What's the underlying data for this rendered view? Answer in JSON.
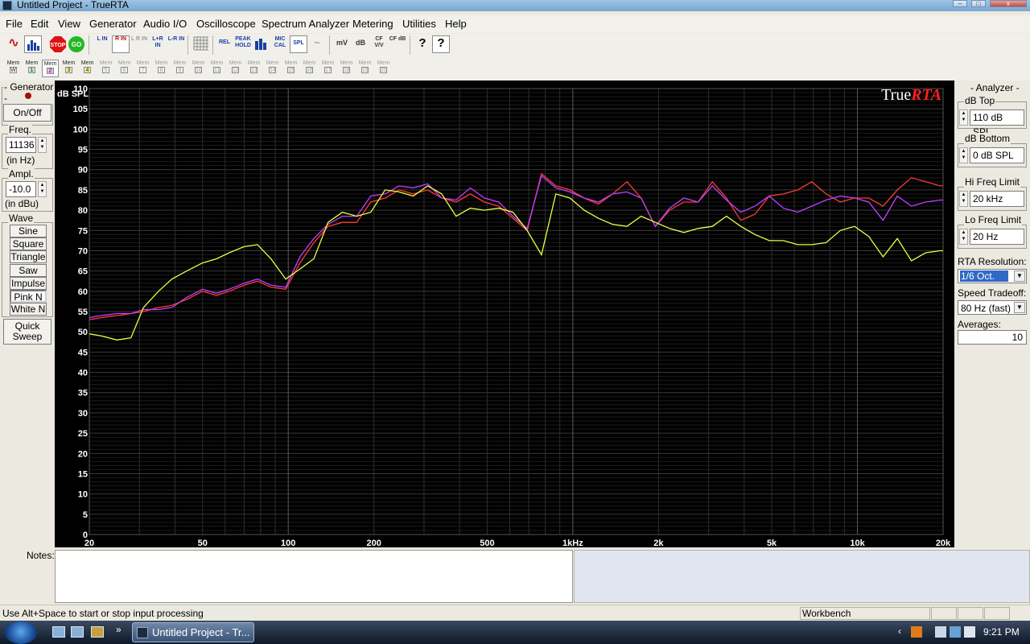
{
  "window": {
    "title": "Untitled Project - TrueRTA",
    "min": "–",
    "max": "□",
    "close": "x"
  },
  "menu": [
    "File",
    "Edit",
    "View",
    "Generator",
    "Audio I/O",
    "Oscilloscope",
    "Spectrum Analyzer",
    "Metering",
    "Utilities",
    "Help"
  ],
  "toolbar": {
    "buttons": [
      {
        "name": "sine-wave",
        "label": "∿"
      },
      {
        "name": "rta-bars",
        "label": ""
      },
      {
        "name": "stop",
        "label": "STOP"
      },
      {
        "name": "go",
        "label": "GO"
      },
      {
        "name": "l-in",
        "label": "L IN"
      },
      {
        "name": "r-in",
        "label": "R IN"
      },
      {
        "name": "l-r-in",
        "label": "L R IN"
      },
      {
        "name": "l-plus-r-in",
        "label": "L+R IN"
      },
      {
        "name": "l-minus-r-in",
        "label": "L-R IN"
      },
      {
        "name": "grid",
        "label": ""
      },
      {
        "name": "rel",
        "label": "REL"
      },
      {
        "name": "peak-hold",
        "label": "PEAK HOLD"
      },
      {
        "name": "bar-graph",
        "label": ""
      },
      {
        "name": "mic-cal",
        "label": "MIC CAL"
      },
      {
        "name": "spl",
        "label": "SPL"
      },
      {
        "name": "weighting",
        "label": "~"
      },
      {
        "name": "mv",
        "label": "mV"
      },
      {
        "name": "db",
        "label": "dB"
      },
      {
        "name": "cf-vv",
        "label": "CF V/V"
      },
      {
        "name": "cf-db",
        "label": "CF dB"
      },
      {
        "name": "help",
        "label": "?"
      },
      {
        "name": "context-help",
        "label": "?"
      }
    ],
    "mem_label": "Mem",
    "mem_buttons": [
      "W",
      "1",
      "2",
      "3",
      "4",
      "5",
      "6",
      "7",
      "8",
      "9",
      "10",
      "11",
      "12",
      "13",
      "14",
      "15",
      "16",
      "17",
      "18",
      "19",
      "20"
    ]
  },
  "generator": {
    "title": "- Generator -",
    "onoff": "On/Off",
    "freq_label": "Freq.",
    "freq_value": "11136",
    "freq_unit": "(in Hz)",
    "ampl_label": "Ampl.",
    "ampl_value": "-10.0",
    "ampl_unit": "(in dBu)",
    "wave_label": "Wave",
    "waves": [
      "Sine",
      "Square",
      "Triangle",
      "Saw",
      "Impulse",
      "Pink N",
      "White N"
    ],
    "selected_wave": "Pink N",
    "quick_sweep": "Quick\nSweep"
  },
  "analyzer": {
    "title": "- Analyzer -",
    "db_top_label": "dB Top",
    "db_top_value": "110 dB SPL",
    "db_bottom_label": "dB Bottom",
    "db_bottom_value": "0 dB SPL",
    "hi_freq_label": "Hi Freq Limit",
    "hi_freq_value": "20 kHz",
    "lo_freq_label": "Lo Freq Limit",
    "lo_freq_value": "20 Hz",
    "resolution_label": "RTA Resolution:",
    "resolution_value": "1/6 Oct.",
    "speed_label": "Speed Tradeoff:",
    "speed_value": "80 Hz (fast)",
    "averages_label": "Averages:",
    "averages_value": "10"
  },
  "notes_label": "Notes:",
  "status": {
    "message": "Use Alt+Space to start or stop input processing",
    "workbench": "Workbench"
  },
  "taskbar": {
    "task": "Untitled Project - Tr...",
    "time": "9:21 PM"
  },
  "chart_data": {
    "type": "line",
    "logo": "TrueRTA",
    "ylabel": "dB SPL",
    "ylim": [
      0,
      110
    ],
    "xlim": [
      20,
      20000
    ],
    "x_scale": "log",
    "grid": true,
    "yticks": [
      0,
      5,
      10,
      15,
      20,
      25,
      30,
      35,
      40,
      45,
      50,
      55,
      60,
      65,
      70,
      75,
      80,
      85,
      90,
      95,
      100,
      105,
      110
    ],
    "xticks": [
      {
        "v": 20,
        "label": "20"
      },
      {
        "v": 50,
        "label": "50"
      },
      {
        "v": 100,
        "label": "100"
      },
      {
        "v": 200,
        "label": "200"
      },
      {
        "v": 500,
        "label": "500"
      },
      {
        "v": 1000,
        "label": "1kHz"
      },
      {
        "v": 2000,
        "label": "2k"
      },
      {
        "v": 5000,
        "label": "5k"
      },
      {
        "v": 10000,
        "label": "10k"
      },
      {
        "v": 20000,
        "label": "20k"
      }
    ],
    "x": [
      20,
      22,
      25,
      28,
      31,
      35,
      39,
      44,
      50,
      56,
      62,
      70,
      78,
      87,
      98,
      110,
      123,
      138,
      155,
      174,
      195,
      219,
      245,
      275,
      309,
      346,
      389,
      436,
      489,
      549,
      616,
      691,
      776,
      871,
      977,
      1096,
      1230,
      1380,
      1549,
      1738,
      1950,
      2188,
      2455,
      2754,
      3090,
      3467,
      3890,
      4365,
      4898,
      5495,
      6166,
      6918,
      7762,
      8710,
      9772,
      10965,
      12303,
      13804,
      15488,
      17378,
      19498,
      20000
    ],
    "series": [
      {
        "color": "#ff3a3a",
        "values": [
          53,
          53.5,
          54,
          54.5,
          55,
          56,
          56.5,
          58,
          60,
          59,
          60,
          61.5,
          62.5,
          61,
          60.5,
          67,
          72,
          76,
          77,
          77,
          82,
          83,
          85,
          84,
          85,
          83,
          82,
          84,
          82,
          81,
          78,
          75,
          89,
          86,
          85,
          83,
          81.5,
          84,
          87,
          83,
          76,
          80,
          82,
          82,
          87,
          83,
          77.5,
          79,
          83.5,
          84,
          85,
          87,
          84,
          82,
          83,
          83,
          81,
          85,
          88,
          87,
          86,
          86
        ]
      },
      {
        "color": "#c040ff",
        "values": [
          53.5,
          54,
          54.5,
          54.5,
          55.5,
          55.5,
          56,
          58.5,
          60.5,
          59.5,
          60.5,
          62,
          63,
          61.5,
          61,
          68.5,
          73,
          76.5,
          78.5,
          78.5,
          83.5,
          84,
          86,
          85.5,
          86.5,
          83,
          82.5,
          85.5,
          83,
          82,
          78.5,
          75.5,
          88.5,
          85.5,
          84.5,
          83,
          82,
          84,
          84.5,
          83,
          76,
          80.5,
          83,
          82,
          86,
          82.5,
          79.5,
          81,
          83.5,
          80.5,
          79.5,
          81,
          82.5,
          83.5,
          83,
          82,
          77.5,
          83.5,
          81,
          82,
          82.5,
          82.5
        ]
      },
      {
        "color": "#e8ff40",
        "values": [
          49.5,
          49,
          48,
          48.5,
          56,
          60,
          63,
          65,
          67,
          68,
          69.5,
          71,
          71.5,
          68,
          63,
          65.5,
          68,
          77,
          79.5,
          78.5,
          79.5,
          85,
          84.5,
          83.5,
          86,
          84,
          78.5,
          80.5,
          80,
          80.5,
          79.5,
          75,
          69,
          84,
          83,
          80,
          78,
          76.5,
          76,
          78.5,
          77,
          75.5,
          74.5,
          75.5,
          76,
          78.5,
          76,
          74,
          72.5,
          72.5,
          71.5,
          71.5,
          72,
          75,
          76,
          73.5,
          68.5,
          73,
          67.5,
          69.5,
          70,
          70
        ]
      }
    ]
  }
}
